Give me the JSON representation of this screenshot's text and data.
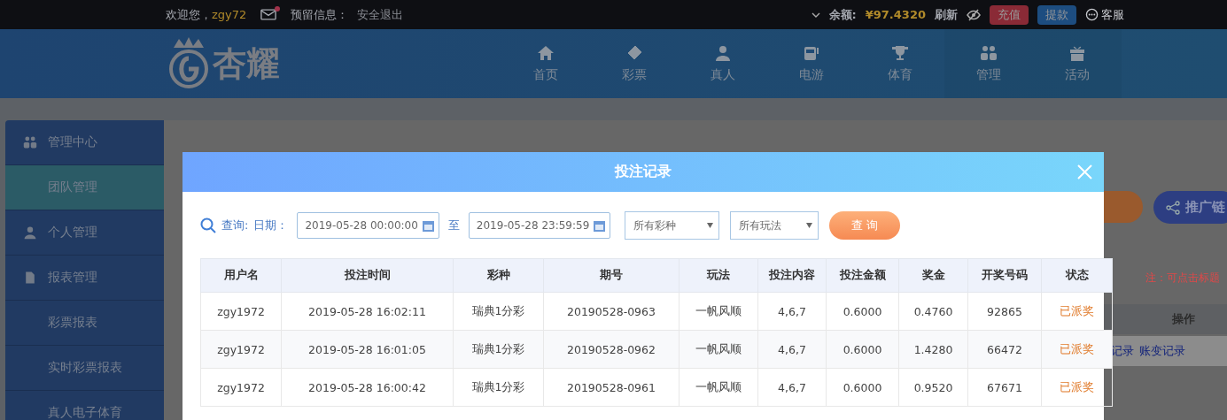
{
  "top_bar": {
    "welcome": "欢迎您，",
    "username": "zgy72",
    "has_unread_mail": true,
    "reserved_info": "预留信息：",
    "logout": "安全退出",
    "balance_label": "余额:",
    "balance": "¥97.4320",
    "refresh": "刷新",
    "deposit": "充值",
    "withdraw": "提款",
    "support": "客服"
  },
  "logo": {
    "text": "杏耀"
  },
  "nav": [
    {
      "label": "首页"
    },
    {
      "label": "彩票"
    },
    {
      "label": "真人"
    },
    {
      "label": "电游"
    },
    {
      "label": "体育"
    },
    {
      "label": "管理"
    },
    {
      "label": "活动"
    }
  ],
  "sidebar": [
    {
      "label": "管理中心",
      "kind": "section",
      "selected": false
    },
    {
      "label": "团队管理",
      "kind": "item",
      "selected": true
    },
    {
      "label": "个人管理",
      "kind": "section",
      "selected": false
    },
    {
      "label": "报表管理",
      "kind": "section",
      "selected": false
    },
    {
      "label": "彩票报表",
      "kind": "item",
      "selected": false
    },
    {
      "label": "实时彩票报表",
      "kind": "item",
      "selected": false
    },
    {
      "label": "真人电子体育",
      "kind": "item",
      "selected": false
    }
  ],
  "page": {
    "promo_link": "推广链",
    "note": "注：可点击标题",
    "action_header": "操作",
    "bet_record_link": "记录",
    "ledger_link": "账变记录"
  },
  "modal": {
    "title": "投注记录",
    "query_label": "查询:",
    "date_label": "日期：",
    "date_from": "2019-05-28 00:00:00",
    "to_label": "至",
    "date_to": "2019-05-28 23:59:59",
    "lottery_select": "所有彩种",
    "play_select": "所有玩法",
    "search_button": "查 询",
    "columns": [
      "用户名",
      "投注时间",
      "彩种",
      "期号",
      "玩法",
      "投注内容",
      "投注金额",
      "奖金",
      "开奖号码",
      "状态"
    ],
    "rows": [
      [
        "zgy1972",
        "2019-05-28 16:02:11",
        "瑞典1分彩",
        "20190528-0963",
        "一帆风顺",
        "4,6,7",
        "0.6000",
        "0.4760",
        "92865",
        "已派奖"
      ],
      [
        "zgy1972",
        "2019-05-28 16:01:05",
        "瑞典1分彩",
        "20190528-0962",
        "一帆风顺",
        "4,6,7",
        "0.6000",
        "1.4280",
        "66472",
        "已派奖"
      ],
      [
        "zgy1972",
        "2019-05-28 16:00:42",
        "瑞典1分彩",
        "20190528-0961",
        "一帆风顺",
        "4,6,7",
        "0.6000",
        "0.9520",
        "67671",
        "已派奖"
      ]
    ]
  }
}
